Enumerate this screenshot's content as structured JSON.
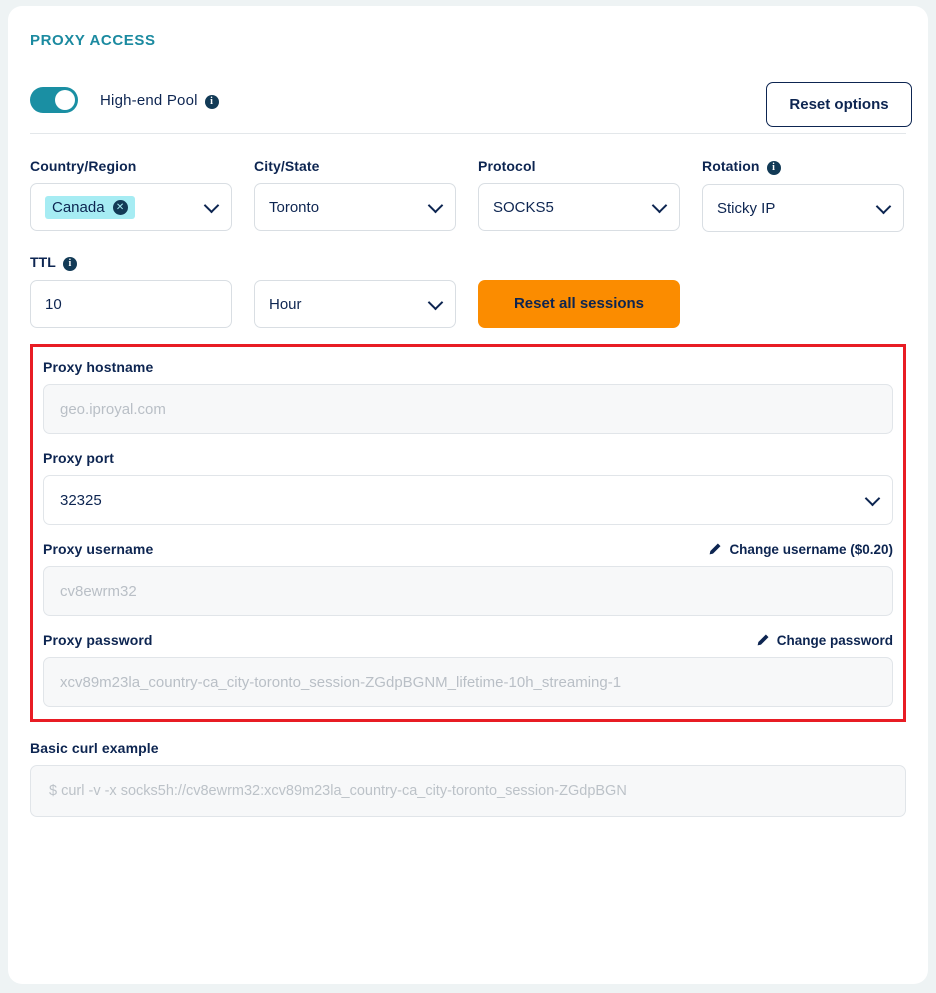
{
  "section": {
    "title": "PROXY ACCESS"
  },
  "toggle": {
    "label": "High-end Pool",
    "info_icon": "info-icon",
    "state": "on",
    "color": "#1a8fa3"
  },
  "reset_options_button": {
    "label": "Reset options"
  },
  "filters": [
    {
      "label": "Country/Region",
      "value": "Canada",
      "is_chip": true,
      "remove_icon": "close-icon",
      "chevron": "chevron-down-icon"
    },
    {
      "label": "City/State",
      "value": "Toronto",
      "is_chip": false,
      "chevron": "chevron-down-icon"
    },
    {
      "label": "Protocol",
      "value": "SOCKS5",
      "is_chip": false,
      "chevron": "chevron-down-icon"
    },
    {
      "label": "Rotation",
      "value": "Sticky IP",
      "is_chip": false,
      "info_icon": "info-icon",
      "chevron": "chevron-down-icon"
    }
  ],
  "ttl": {
    "label": "TTL",
    "info_icon": "info-icon",
    "value": "10",
    "unit": "Hour",
    "unit_chevron": "chevron-down-icon",
    "reset_sessions_label": "Reset all sessions",
    "reset_sessions_color": "#fb8c00"
  },
  "highlight": {
    "border_color": "#e81c24"
  },
  "credentials": {
    "hostname": {
      "label": "Proxy hostname",
      "placeholder": "geo.iproyal.com"
    },
    "port": {
      "label": "Proxy port",
      "value": "32325",
      "chevron": "chevron-down-icon"
    },
    "username": {
      "label": "Proxy username",
      "placeholder": "cv8ewrm32",
      "action_label": "Change username ($0.20)",
      "action_icon": "pencil-icon"
    },
    "password": {
      "label": "Proxy password",
      "placeholder": "xcv89m23la_country-ca_city-toronto_session-ZGdpBGNM_lifetime-10h_streaming-1",
      "action_label": "Change password",
      "action_icon": "pencil-icon"
    }
  },
  "curl": {
    "label": "Basic curl example",
    "placeholder": "$ curl -v -x socks5h://cv8ewrm32:xcv89m23la_country-ca_city-toronto_session-ZGdpBGN"
  }
}
